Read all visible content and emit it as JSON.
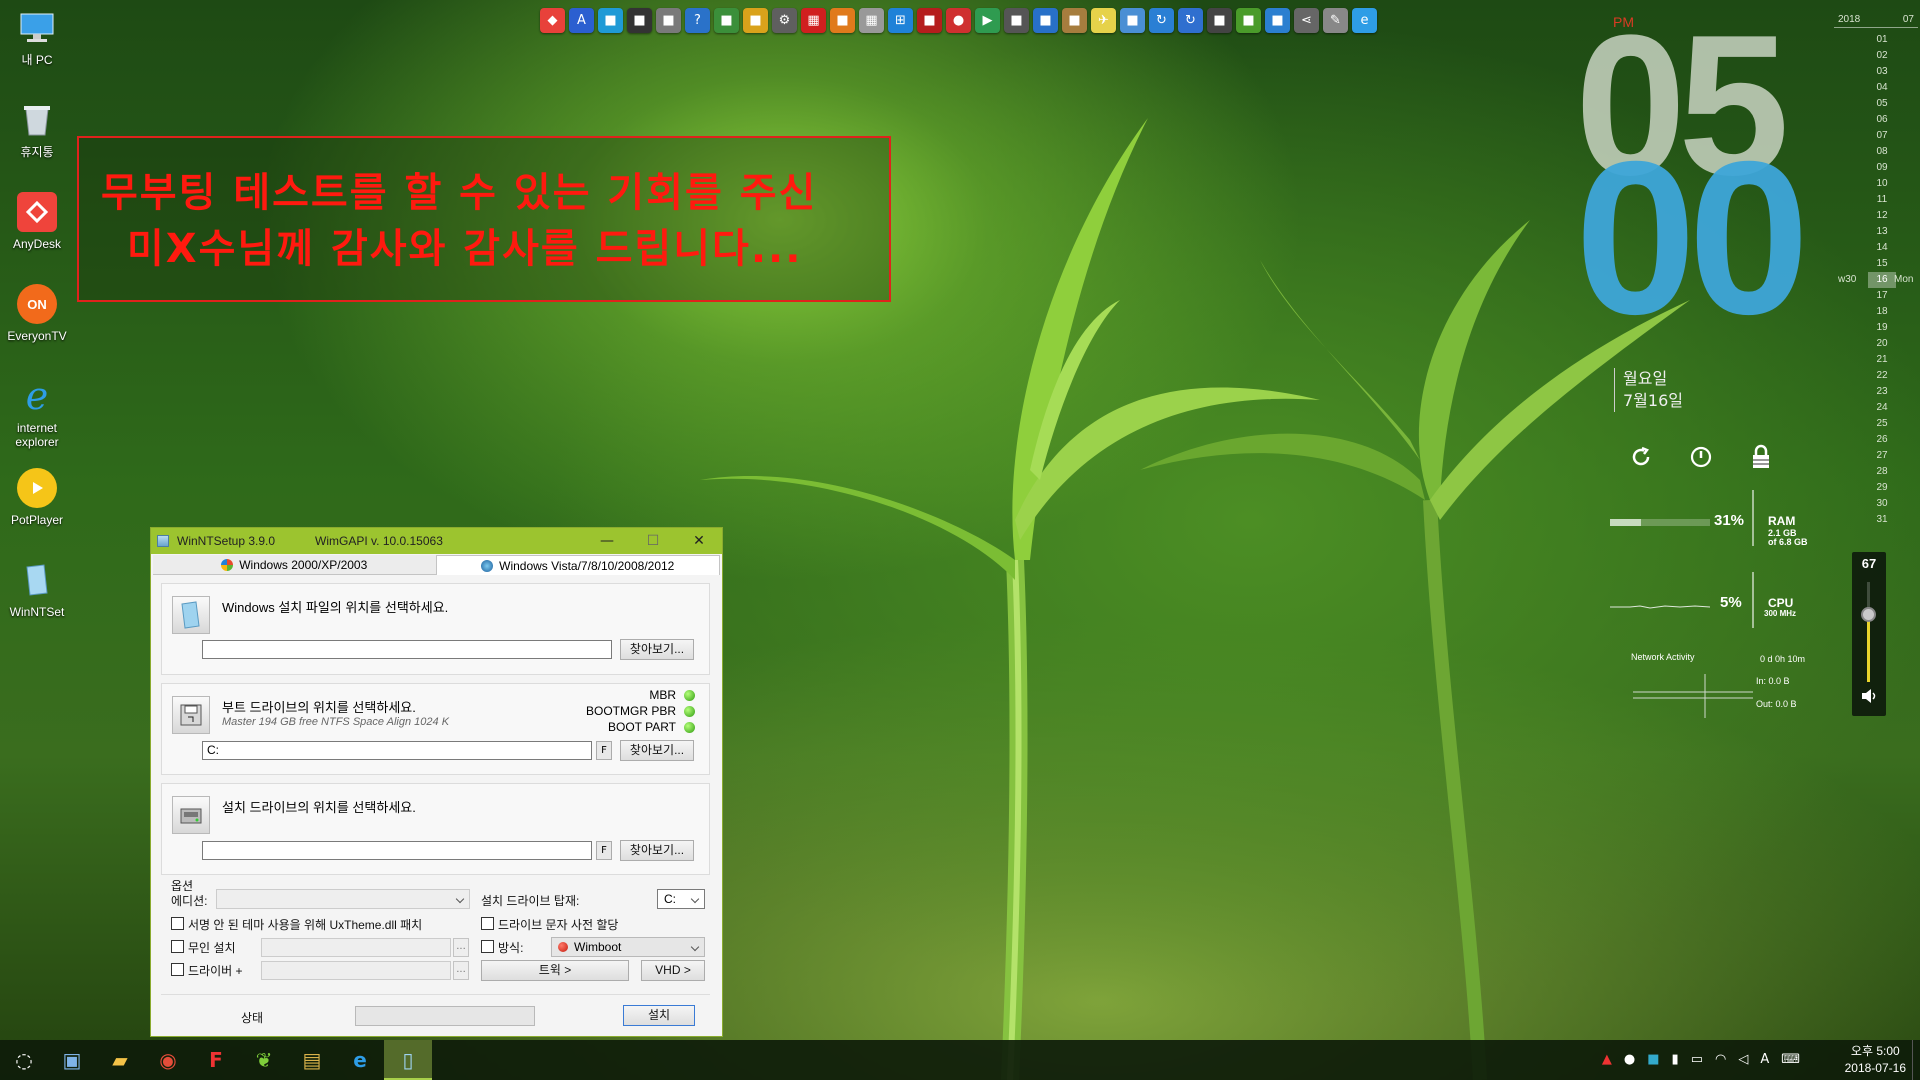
{
  "desktop": {
    "icons": [
      {
        "label": "내 PC",
        "icon": "this-pc-icon"
      },
      {
        "label": "휴지통",
        "icon": "recycle-bin-icon"
      },
      {
        "label": "AnyDesk",
        "icon": "anydesk-icon"
      },
      {
        "label": "EveryonTV",
        "icon": "everyontv-icon"
      },
      {
        "label": "internet explorer",
        "icon": "internet-explorer-icon"
      },
      {
        "label": "PotPlayer",
        "icon": "potplayer-icon"
      },
      {
        "label": "WinNTSet",
        "icon": "winntsetup-icon"
      }
    ]
  },
  "message": {
    "line1": "무부팅 테스트를 할 수 있는 기회를 주신",
    "line2": "미X수님께 감사와 감사를 드립니다...",
    "color": "#ff1a0f"
  },
  "clock": {
    "ampm": "PM",
    "hour": "05",
    "minute": "00",
    "weekday": "월요일",
    "date": "7월16일",
    "accent": "#3ea6d9"
  },
  "system_buttons": [
    "refresh-icon",
    "power-icon",
    "lock-icon"
  ],
  "meters": {
    "ram": {
      "percent_label": "31%",
      "percent": 31,
      "title": "RAM",
      "detail1": "2.1 GB",
      "detail2": "of 6.8 GB"
    },
    "cpu": {
      "percent_label": "5%",
      "percent": 5,
      "title": "CPU",
      "detail": "300 MHz"
    },
    "network": {
      "title": "Network Activity",
      "uptime": "0 d 0h 10m",
      "in": "In: 0.0 B",
      "out": "Out: 0.0 B"
    }
  },
  "calendar": {
    "year": "2018",
    "month": "07",
    "days": [
      "01",
      "02",
      "03",
      "04",
      "05",
      "06",
      "07",
      "08",
      "09",
      "10",
      "11",
      "12",
      "13",
      "14",
      "15",
      "16",
      "17",
      "18",
      "19",
      "20",
      "21",
      "22",
      "23",
      "24",
      "25",
      "26",
      "27",
      "28",
      "29",
      "30",
      "31"
    ],
    "today_index": 15,
    "week_label": "w30",
    "weekday_label": "Mon"
  },
  "volume": {
    "value": "67",
    "level": 67
  },
  "window": {
    "title": "WinNTSetup 3.9.0",
    "api": "WimGAPI v. 10.0.15063",
    "tabs": [
      {
        "label": "Windows 2000/XP/2003",
        "active": false
      },
      {
        "label": "Windows Vista/7/8/10/2008/2012",
        "active": true
      }
    ],
    "source": {
      "title": "Windows 설치 파일의 위치를 선택하세요.",
      "value": "",
      "browse": "찾아보기..."
    },
    "boot": {
      "title": "부트 드라이브의 위치를 선택하세요.",
      "subtitle": "Master 194 GB free NTFS Space Align 1024 K",
      "value": "C:",
      "f_label": "F",
      "browse": "찾아보기...",
      "status": [
        "MBR",
        "BOOTMGR PBR",
        "BOOT PART"
      ]
    },
    "install": {
      "title": "설치 드라이브의 위치를 선택하세요.",
      "value": "",
      "f_label": "F",
      "browse": "찾아보기..."
    },
    "options": {
      "header": "옵션",
      "edition_label": "에디션:",
      "mount_label": "설치 드라이브 탑재:",
      "mount_value": "C:",
      "uxtheme": "서명 안 된 테마 사용을 위해 UxTheme.dll 패치",
      "predrive": "드라이브 문자 사전 할당",
      "unattend": "무인 설치",
      "method_label": "방식:",
      "method_value": "Wimboot",
      "drivers": "드라이버 +",
      "tweaks": "트윅 >",
      "vhd": "VHD >",
      "ellipsis": "..."
    },
    "status_label": "상태",
    "setup": "설치"
  },
  "dock": {
    "icons": [
      "anydesk",
      "word-a",
      "circle-app",
      "color-wheel",
      "archive",
      "help-globe",
      "game-pad",
      "paint",
      "settings",
      "red-grid",
      "orange-doc",
      "calc",
      "windows-logo",
      "car",
      "apple",
      "media-play",
      "puzzle",
      "chrome-like",
      "disc",
      "bird",
      "blue-doc",
      "refresh",
      "ie-refresh",
      "monitor",
      "green-terminal",
      "windows-flag",
      "share",
      "pen",
      "internet-explorer"
    ]
  },
  "taskbar": {
    "icons": [
      "start-icon",
      "computer-icon",
      "folder-icon",
      "chrome-icon",
      "red-f-icon",
      "leaf-icon",
      "archive-icon",
      "internet-explorer-icon",
      "winntsetup-icon"
    ],
    "active_index": 8,
    "tray": [
      "up-arrow-icon",
      "drop-icon",
      "color-icon",
      "usb-icon",
      "battery-icon",
      "wifi-icon",
      "speaker-icon",
      "ime-a-icon",
      "keyboard-icon"
    ],
    "time": "오후 5:00",
    "date": "2018-07-16"
  }
}
